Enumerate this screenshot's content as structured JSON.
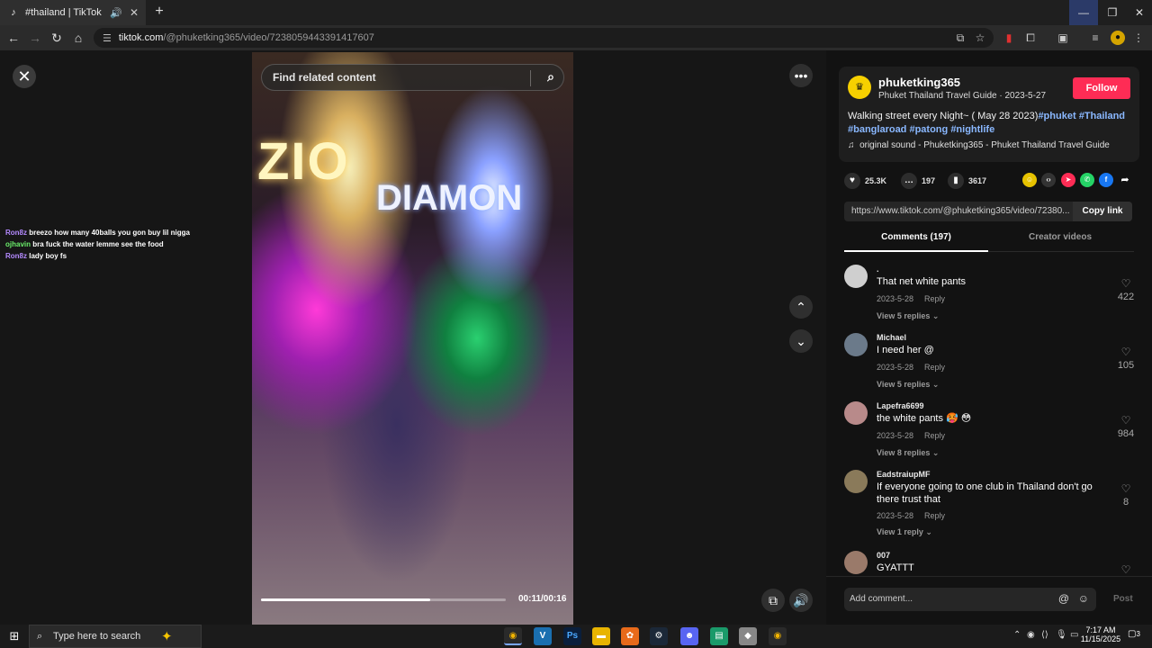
{
  "browser": {
    "tab_title": "#thailand | TikTok",
    "url_host": "tiktok.com",
    "url_path": "/@phuketking365/video/7238059443391417607"
  },
  "stream_chat": [
    {
      "user": "Ron8z",
      "text": "breezo how many 40balls you gon buy lil nigga"
    },
    {
      "user": "ojhavin",
      "text": "bra fuck the water lemme see the food"
    },
    {
      "user": "Ron8z",
      "text": "lady boy fs"
    }
  ],
  "video": {
    "search_placeholder": "Find related content",
    "time": "00:11/00:16",
    "progress": 0.69,
    "sign_text_1": "ZIO",
    "sign_text_2": "DIAMON"
  },
  "author": {
    "name": "phuketking365",
    "subtitle": "Phuket Thailand Travel Guide · 2023-5-27",
    "follow_label": "Follow"
  },
  "description": {
    "text": "Walking street every Night~ ( May 28 2023)",
    "tags": [
      "#phuket",
      "#Thailand",
      "#banglaroad",
      "#patong",
      "#nightlife"
    ],
    "sound": "original sound - Phuketking365 - Phuket Thailand Travel Guide"
  },
  "stats": {
    "likes": "25.3K",
    "comments": "197",
    "saves": "3617"
  },
  "share_link": {
    "url": "https://www.tiktok.com/@phuketking365/video/72380...",
    "copy_label": "Copy link"
  },
  "panel_tabs": {
    "comments": "Comments (197)",
    "creator": "Creator videos"
  },
  "comments": [
    {
      "user": ".",
      "text": "That net white pants",
      "date": "2023-5-28",
      "reply": "Reply",
      "replies": "View 5 replies",
      "likes": "422"
    },
    {
      "user": "Michael",
      "text": "I need her @",
      "date": "2023-5-28",
      "reply": "Reply",
      "replies": "View 5 replies",
      "likes": "105"
    },
    {
      "user": "Lapefra6699",
      "text": "the white pants 🥵 😳",
      "date": "2023-5-28",
      "reply": "Reply",
      "replies": "View 8 replies",
      "likes": "984"
    },
    {
      "user": "EadstraiupMF",
      "text": "If everyone going to one club in Thailand don't go there trust that",
      "date": "2023-5-28",
      "reply": "Reply",
      "replies": "View 1 reply",
      "likes": "8"
    },
    {
      "user": "007",
      "text": "GYATTT",
      "date": "",
      "reply": "",
      "replies": "",
      "likes": ""
    }
  ],
  "add_comment": {
    "placeholder": "Add comment...",
    "post_label": "Post"
  },
  "taskbar": {
    "search_placeholder": "Type here to search",
    "time": "7:17 AM",
    "date": "11/15/2025",
    "notifications": "3"
  }
}
